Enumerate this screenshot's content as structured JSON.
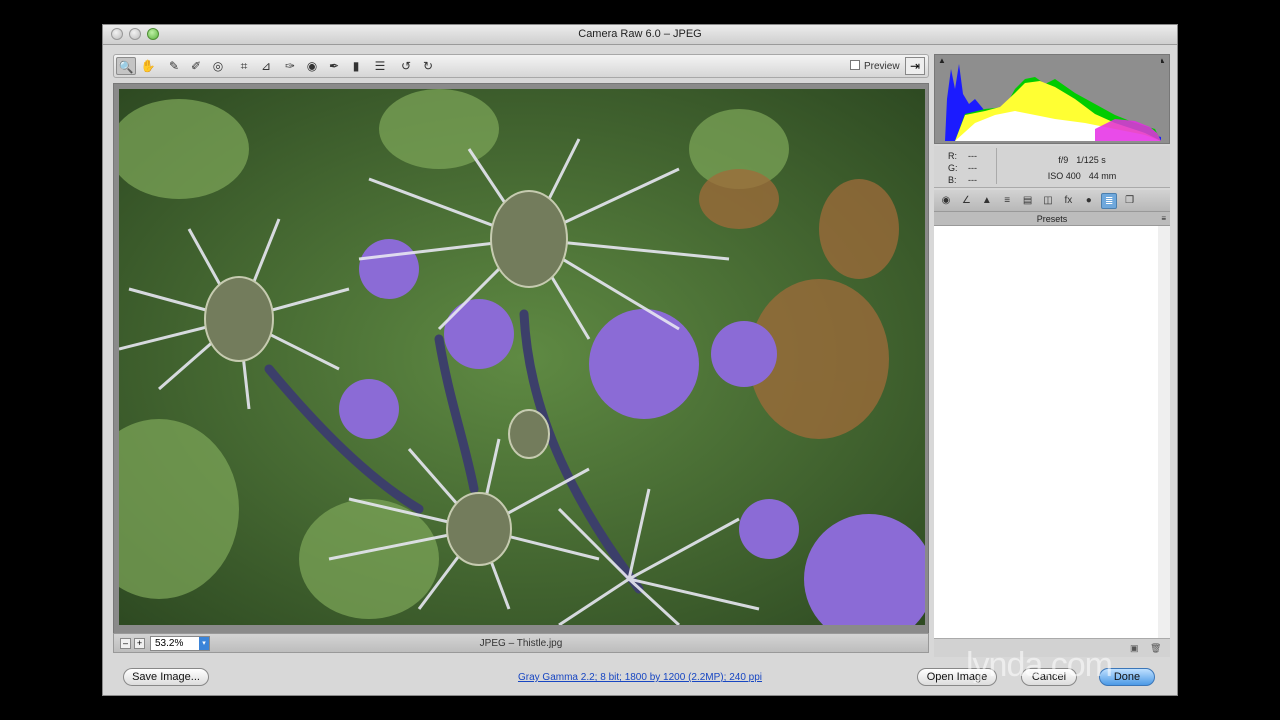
{
  "window": {
    "title": "Camera Raw 6.0  –  JPEG"
  },
  "toolbar": {
    "tools": [
      {
        "name": "zoom-tool-icon",
        "glyph": "🔍"
      },
      {
        "name": "hand-tool-icon",
        "glyph": "✋"
      },
      {
        "name": "white-balance-tool-icon",
        "glyph": "✎"
      },
      {
        "name": "color-sampler-tool-icon",
        "glyph": "✐"
      },
      {
        "name": "targeted-adjustment-tool-icon",
        "glyph": "◎"
      },
      {
        "name": "crop-tool-icon",
        "glyph": "⌗"
      },
      {
        "name": "straighten-tool-icon",
        "glyph": "⊿"
      },
      {
        "name": "spot-removal-tool-icon",
        "glyph": "✑"
      },
      {
        "name": "red-eye-tool-icon",
        "glyph": "◉"
      },
      {
        "name": "adjustment-brush-icon",
        "glyph": "✒"
      },
      {
        "name": "graduated-filter-icon",
        "glyph": "▮"
      },
      {
        "name": "preferences-icon",
        "glyph": "☰"
      },
      {
        "name": "rotate-left-icon",
        "glyph": "↺"
      },
      {
        "name": "rotate-right-icon",
        "glyph": "↻"
      }
    ],
    "preview_label": "Preview",
    "fullscreen_glyph": "⇥"
  },
  "status": {
    "zoom_value": "53.2%",
    "filename": "JPEG  –  Thistle.jpg",
    "zoom_out": "–",
    "zoom_in": "+"
  },
  "histogram": {
    "clip_left": "▲",
    "clip_right": "▲"
  },
  "info": {
    "r_label": "R:",
    "g_label": "G:",
    "b_label": "B:",
    "r_value": "---",
    "g_value": "---",
    "b_value": "---",
    "aperture": "f/9",
    "shutter": "1/125 s",
    "iso": "ISO 400",
    "focal": "44 mm"
  },
  "panel_tabs": [
    {
      "name": "basic-tab-icon",
      "glyph": "◉"
    },
    {
      "name": "tone-curve-tab-icon",
      "glyph": "∠"
    },
    {
      "name": "detail-tab-icon",
      "glyph": "▲"
    },
    {
      "name": "hsl-tab-icon",
      "glyph": "≡"
    },
    {
      "name": "split-toning-tab-icon",
      "glyph": "▤"
    },
    {
      "name": "lens-corrections-tab-icon",
      "glyph": "◫"
    },
    {
      "name": "effects-tab-icon",
      "glyph": "fx"
    },
    {
      "name": "camera-calibration-tab-icon",
      "glyph": "●"
    },
    {
      "name": "presets-tab-icon",
      "glyph": "≣"
    },
    {
      "name": "snapshots-tab-icon",
      "glyph": "❐"
    }
  ],
  "presets": {
    "title": "Presets",
    "menu_glyph": "≡"
  },
  "buttons": {
    "save_image": "Save Image...",
    "open_image": "Open Image",
    "cancel": "Cancel",
    "done": "Done"
  },
  "workflow_options": "Gray Gamma 2.2; 8 bit; 1800 by 1200 (2.2MP); 240 ppi",
  "watermark": "lynda.com"
}
